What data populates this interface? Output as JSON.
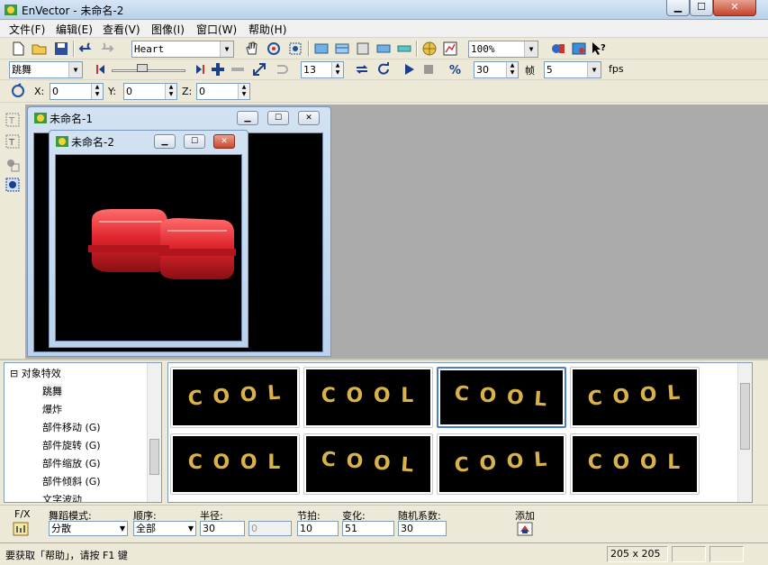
{
  "window": {
    "title": "EnVector - 未命名-2"
  },
  "menu": [
    "文件(F)",
    "编辑(E)",
    "查看(V)",
    "图像(I)",
    "窗口(W)",
    "帮助(H)"
  ],
  "toolbar1": {
    "shape": "Heart",
    "zoom": "100%"
  },
  "toolbar2": {
    "effect": "跳舞",
    "frame_value": "13",
    "speed_value": "30",
    "frame_label": "帧",
    "fps_value": "5",
    "fps_label": "fps"
  },
  "toolbar3": {
    "x_label": "X:",
    "x_value": "0",
    "y_label": "Y:",
    "y_value": "0",
    "z_label": "Z:",
    "z_value": "0"
  },
  "mdi": {
    "window1_title": "未命名-1",
    "window2_title": "未命名-2"
  },
  "tree": {
    "root": "对象特效",
    "items": [
      "跳舞",
      "爆炸",
      "部件移动 (G)",
      "部件旋转 (G)",
      "部件缩放 (G)",
      "部件倾斜 (G)",
      "文字波动"
    ]
  },
  "gallery": {
    "thumbs": [
      "C O O L",
      "C O O L",
      "C O O L",
      "C O O L",
      "C O O L",
      "C O O L",
      "C O O L",
      "C O O L"
    ],
    "selected_index": 2
  },
  "params": {
    "fx_label": "F/X",
    "dance_mode_label": "舞蹈模式:",
    "dance_mode_value": "分散",
    "order_label": "顺序:",
    "order_value": "全部",
    "radius_label": "半径:",
    "radius_value": "30",
    "radius2_value": "0",
    "beat_label": "节拍:",
    "beat_value": "10",
    "change_label": "变化:",
    "change_value": "51",
    "random_label": "随机系数:",
    "random_value": "30",
    "add_label": "添加"
  },
  "status": {
    "help_text": "要获取「帮助」，请按 F1 键",
    "size": "205 x 205"
  },
  "colors": {
    "canvas": "#000000",
    "shape_red": "#e0262e",
    "gold": "#d9b24a",
    "selection": "#4a7fc8"
  }
}
